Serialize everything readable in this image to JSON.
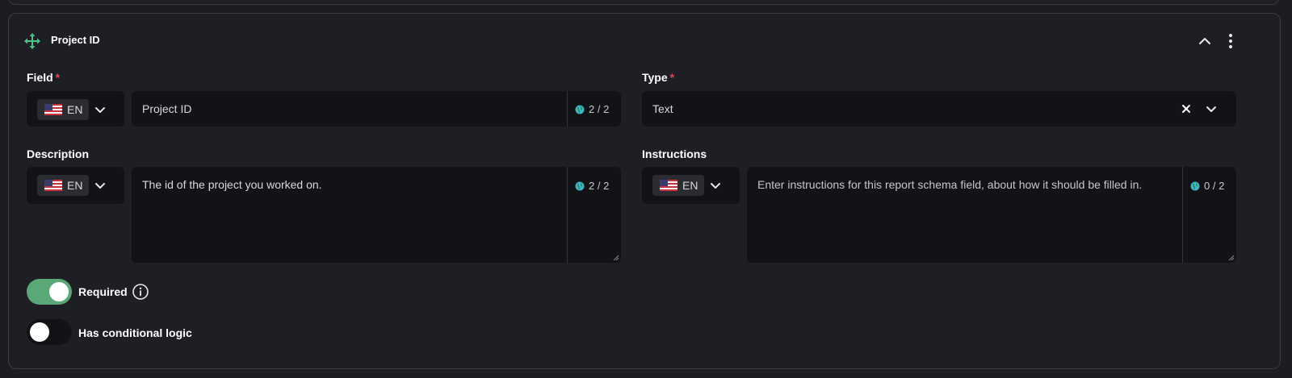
{
  "card": {
    "title": "Project ID"
  },
  "field": {
    "label": "Field",
    "required_mark": "*",
    "lang": "EN",
    "value": "Project ID",
    "counter": "2 / 2"
  },
  "type": {
    "label": "Type",
    "required_mark": "*",
    "value": "Text"
  },
  "description": {
    "label": "Description",
    "lang": "EN",
    "value": "The id of the project you worked on.",
    "counter": "2 / 2"
  },
  "instructions": {
    "label": "Instructions",
    "lang": "EN",
    "placeholder": "Enter instructions for this report schema field, about how it should be filled in.",
    "counter": "0 / 2"
  },
  "required_toggle": {
    "label": "Required",
    "on": true
  },
  "conditional_toggle": {
    "label": "Has conditional logic",
    "on": false
  },
  "colors": {
    "background": "#1c1d22",
    "input": "#121316",
    "accent_green": "#5aa878",
    "required_red": "#e0445a"
  },
  "icons": [
    "move-icon",
    "chevron-up-icon",
    "kebab-menu-icon",
    "us-flag-icon",
    "chevron-down-icon",
    "globe-icon",
    "clear-icon",
    "info-icon"
  ]
}
